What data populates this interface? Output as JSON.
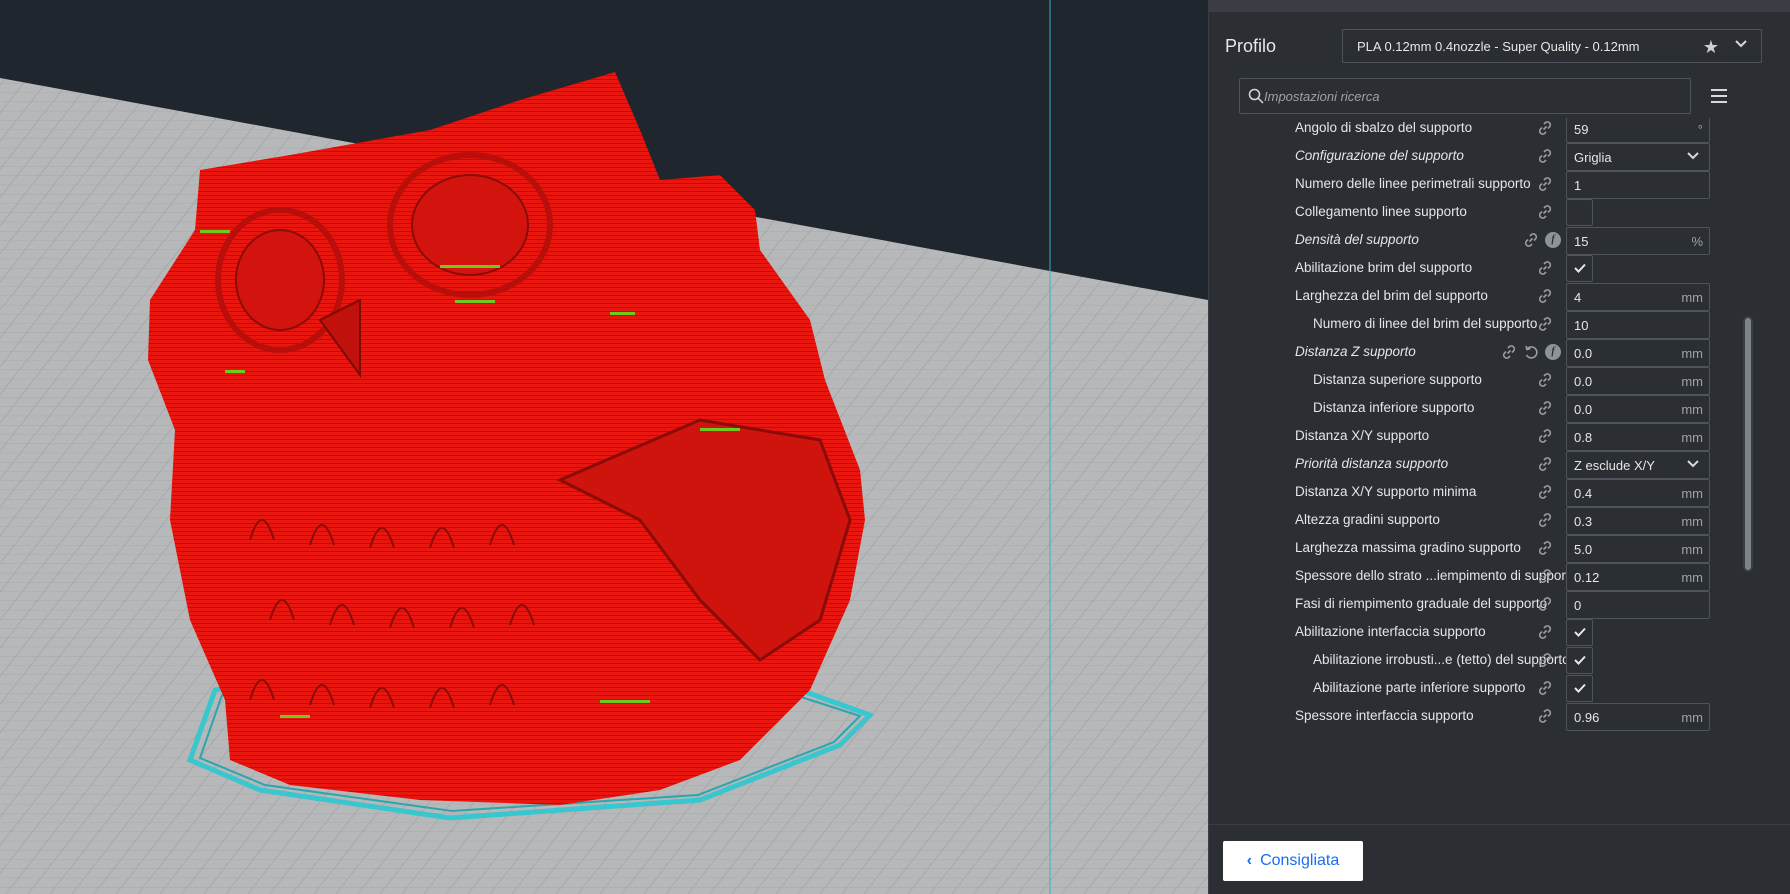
{
  "viewport": {
    "object_color": "#e8160f",
    "brim_color": "#38c6cf",
    "background_color": "#1f262d",
    "build_plate_color": "#b7b8b9",
    "guide_line_color": "#31b7c3"
  },
  "panel": {
    "profile_label": "Profilo",
    "profile_value": "PLA 0.12mm 0.4nozzle - Super Quality - 0.12mm",
    "search_placeholder": "Impostazioni ricerca",
    "settings": [
      {
        "label": "Angolo di sbalzo del supporto",
        "italic": false,
        "indent": false,
        "type": "text",
        "value": "59",
        "unit": "°"
      },
      {
        "label": "Configurazione del supporto",
        "italic": true,
        "indent": false,
        "type": "dropdown",
        "value": "Griglia",
        "unit": ""
      },
      {
        "label": "Numero delle linee perimetrali supporto",
        "italic": false,
        "indent": false,
        "type": "text",
        "value": "1",
        "unit": ""
      },
      {
        "label": "Collegamento linee supporto",
        "italic": false,
        "indent": false,
        "type": "checkbox",
        "checked": false
      },
      {
        "label": "Densità del supporto",
        "italic": true,
        "indent": false,
        "type": "text",
        "value": "15",
        "unit": "%",
        "func": true
      },
      {
        "label": "Abilitazione brim del supporto",
        "italic": false,
        "indent": false,
        "type": "checkbox",
        "checked": true
      },
      {
        "label": "Larghezza del brim del supporto",
        "italic": false,
        "indent": false,
        "type": "text",
        "value": "4",
        "unit": "mm"
      },
      {
        "label": "Numero di linee del brim del supporto",
        "italic": false,
        "indent": true,
        "type": "text",
        "value": "10",
        "unit": ""
      },
      {
        "label": "Distanza Z supporto",
        "italic": true,
        "indent": false,
        "type": "text",
        "value": "0.0",
        "unit": "mm",
        "func": true,
        "reset": true
      },
      {
        "label": "Distanza superiore supporto",
        "italic": false,
        "indent": true,
        "type": "text",
        "value": "0.0",
        "unit": "mm"
      },
      {
        "label": "Distanza inferiore supporto",
        "italic": false,
        "indent": true,
        "type": "text",
        "value": "0.0",
        "unit": "mm"
      },
      {
        "label": "Distanza X/Y supporto",
        "italic": false,
        "indent": false,
        "type": "text",
        "value": "0.8",
        "unit": "mm"
      },
      {
        "label": "Priorità distanza supporto",
        "italic": true,
        "indent": false,
        "type": "dropdown",
        "value": "Z esclude X/Y",
        "unit": ""
      },
      {
        "label": "Distanza X/Y supporto minima",
        "italic": false,
        "indent": false,
        "type": "text",
        "value": "0.4",
        "unit": "mm"
      },
      {
        "label": "Altezza gradini supporto",
        "italic": false,
        "indent": false,
        "type": "text",
        "value": "0.3",
        "unit": "mm"
      },
      {
        "label": "Larghezza massima gradino supporto",
        "italic": false,
        "indent": false,
        "type": "text",
        "value": "5.0",
        "unit": "mm"
      },
      {
        "label": "Spessore dello strato ...iempimento di supporto",
        "italic": false,
        "indent": false,
        "type": "text",
        "value": "0.12",
        "unit": "mm"
      },
      {
        "label": "Fasi di riempimento graduale del supporto",
        "italic": false,
        "indent": false,
        "type": "text",
        "value": "0",
        "unit": ""
      },
      {
        "label": "Abilitazione interfaccia supporto",
        "italic": false,
        "indent": false,
        "type": "checkbox",
        "checked": true
      },
      {
        "label": "Abilitazione irrobusti...e (tetto) del supporto",
        "italic": false,
        "indent": true,
        "type": "checkbox",
        "checked": true
      },
      {
        "label": "Abilitazione parte inferiore supporto",
        "italic": false,
        "indent": true,
        "type": "checkbox",
        "checked": true
      },
      {
        "label": "Spessore interfaccia supporto",
        "italic": false,
        "indent": false,
        "type": "text",
        "value": "0.96",
        "unit": "mm"
      }
    ],
    "recommended_button": "Consigliata"
  }
}
